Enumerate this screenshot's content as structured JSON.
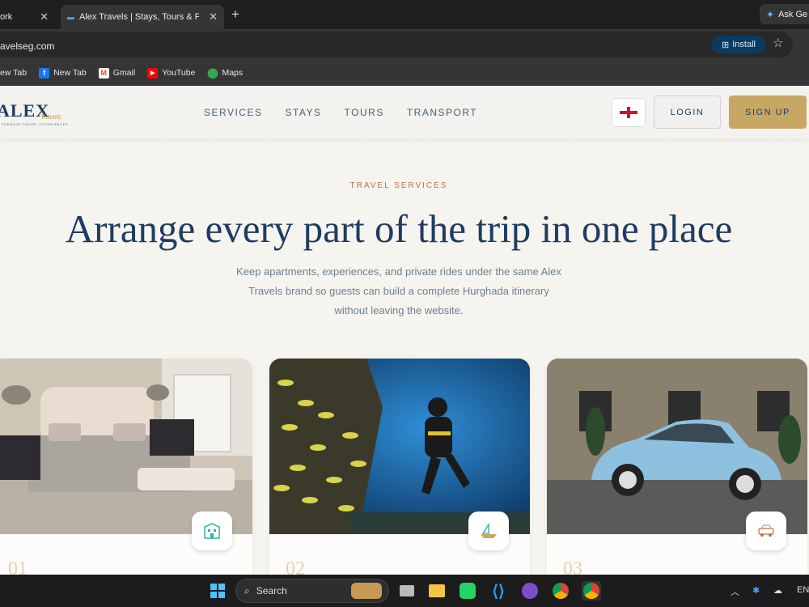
{
  "browser": {
    "tabs": [
      {
        "title": "ork",
        "active": false
      },
      {
        "title": "Alex Travels | Stays, Tours & Private",
        "active": true
      }
    ],
    "new_tab_symbol": "+",
    "ask_gemini": "Ask Ge",
    "url": "avelseg.com",
    "install_label": "Install",
    "bookmarks": [
      {
        "label": "ew Tab",
        "icon": "newtab-icon"
      },
      {
        "label": "New Tab",
        "icon": "facebook-icon"
      },
      {
        "label": "Gmail",
        "icon": "gmail-icon"
      },
      {
        "label": "YouTube",
        "icon": "youtube-icon"
      },
      {
        "label": "Maps",
        "icon": "maps-icon"
      }
    ]
  },
  "site": {
    "logo": {
      "main": "ALEX",
      "script": "Travels",
      "tagline": "PREMIUM TRAVEL EXPERIENCES"
    },
    "nav": [
      "SERVICES",
      "STAYS",
      "TOURS",
      "TRANSPORT"
    ],
    "language_flag": "england-flag-icon",
    "login_label": "LOGIN",
    "signup_label": "SIGN UP",
    "eyebrow": "TRAVEL SERVICES",
    "headline": "Arrange every part of the trip in one place",
    "subtext": "Keep apartments, experiences, and private rides under the same Alex Travels brand so guests can build a complete Hurghada itinerary without leaving the website.",
    "cards": [
      {
        "number": "01",
        "image": "bedroom-photo",
        "badge_icon": "building-icon"
      },
      {
        "number": "02",
        "image": "diver-photo",
        "badge_icon": "boat-icon"
      },
      {
        "number": "03",
        "image": "car-photo",
        "badge_icon": "car-icon"
      }
    ],
    "colors": {
      "navy": "#1f3c62",
      "gold": "#c8a765",
      "accent": "#c46e4a"
    }
  },
  "taskbar": {
    "search_label": "Search",
    "language": "EN"
  }
}
